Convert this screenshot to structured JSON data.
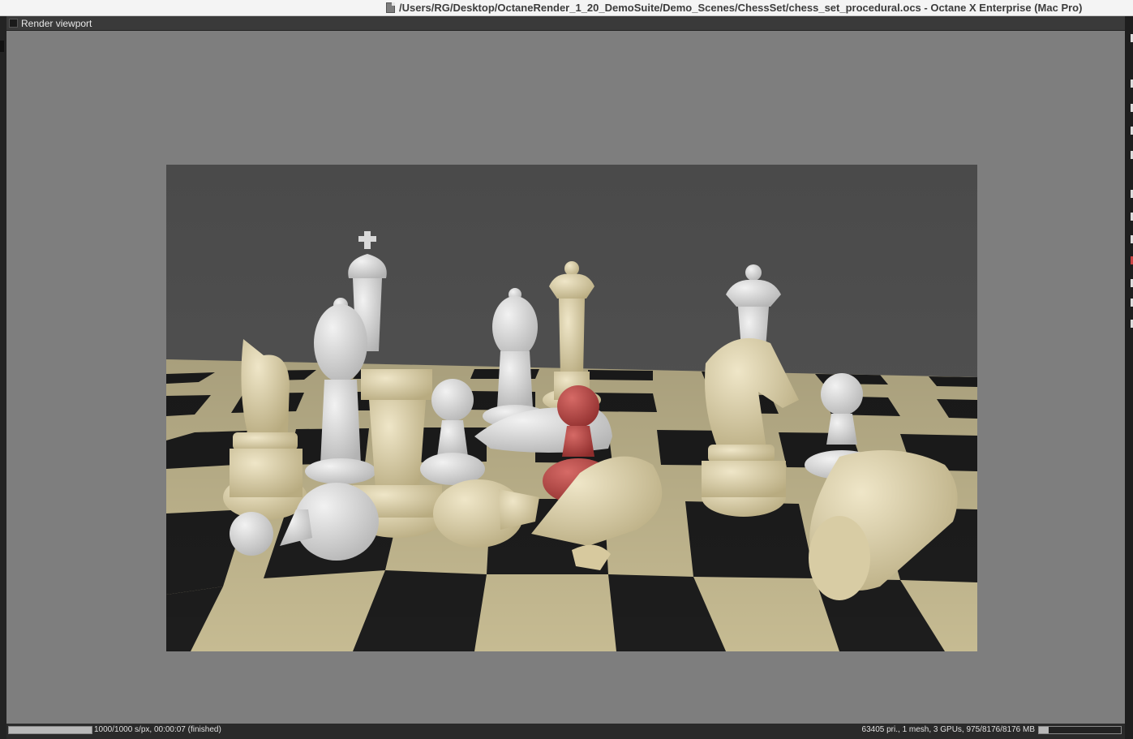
{
  "window": {
    "title": "/Users/RG/Desktop/OctaneRender_1_20_DemoSuite/Demo_Scenes/ChessSet/chess_set_procedural.ocs - Octane X Enterprise (Mac Pro)",
    "doc_icon": "document-icon"
  },
  "panel": {
    "title": "Render viewport"
  },
  "render": {
    "description_icon": "rendered-image",
    "piece_colors": {
      "ivory": "#e3d8b4",
      "white": "#dcdcdc",
      "red": "#b5403f"
    },
    "board_colors": {
      "light": "#c9be95",
      "dark": "#1c1c1c",
      "backdrop": "#4d4d4d"
    }
  },
  "status": {
    "samples_text": "1000/1000 s/px, 00:00:07 (finished)",
    "samples_progress": 1.0,
    "scene_info": "63405 pri., 1 mesh, 3 GPUs, 975/8176/8176 MB",
    "memory_fraction": 0.12
  }
}
